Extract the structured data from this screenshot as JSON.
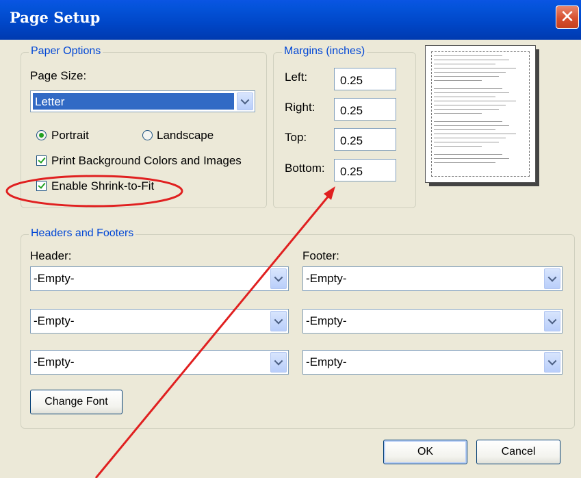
{
  "window": {
    "title": "Page Setup",
    "close_glyph": "✕"
  },
  "paper_options": {
    "legend": "Paper Options",
    "page_size_label": "Page Size:",
    "page_size_value": "Letter",
    "orientation": [
      {
        "label": "Portrait",
        "selected": true
      },
      {
        "label": "Landscape",
        "selected": false
      }
    ],
    "print_background_label": "Print Background Colors and Images",
    "print_background_checked": true,
    "shrink_to_fit_label": "Enable Shrink-to-Fit",
    "shrink_to_fit_checked": true
  },
  "margins": {
    "legend": "Margins (inches)",
    "fields": [
      {
        "label": "Left:",
        "value": "0.25"
      },
      {
        "label": "Right:",
        "value": "0.25"
      },
      {
        "label": "Top:",
        "value": "0.25"
      },
      {
        "label": "Bottom:",
        "value": "0.25"
      }
    ]
  },
  "headers_footers": {
    "legend": "Headers and Footers",
    "header_label": "Header:",
    "footer_label": "Footer:",
    "header_values": [
      "-Empty-",
      "-Empty-",
      "-Empty-"
    ],
    "footer_values": [
      "-Empty-",
      "-Empty-",
      "-Empty-"
    ],
    "change_font_label": "Change Font"
  },
  "buttons": {
    "ok": "OK",
    "cancel": "Cancel"
  },
  "annotation": {
    "color": "#e02020"
  },
  "colors": {
    "title_bar": "#0046c7",
    "legend_text": "#0046d5",
    "selection": "#316ac5",
    "check_green": "#21a121"
  }
}
